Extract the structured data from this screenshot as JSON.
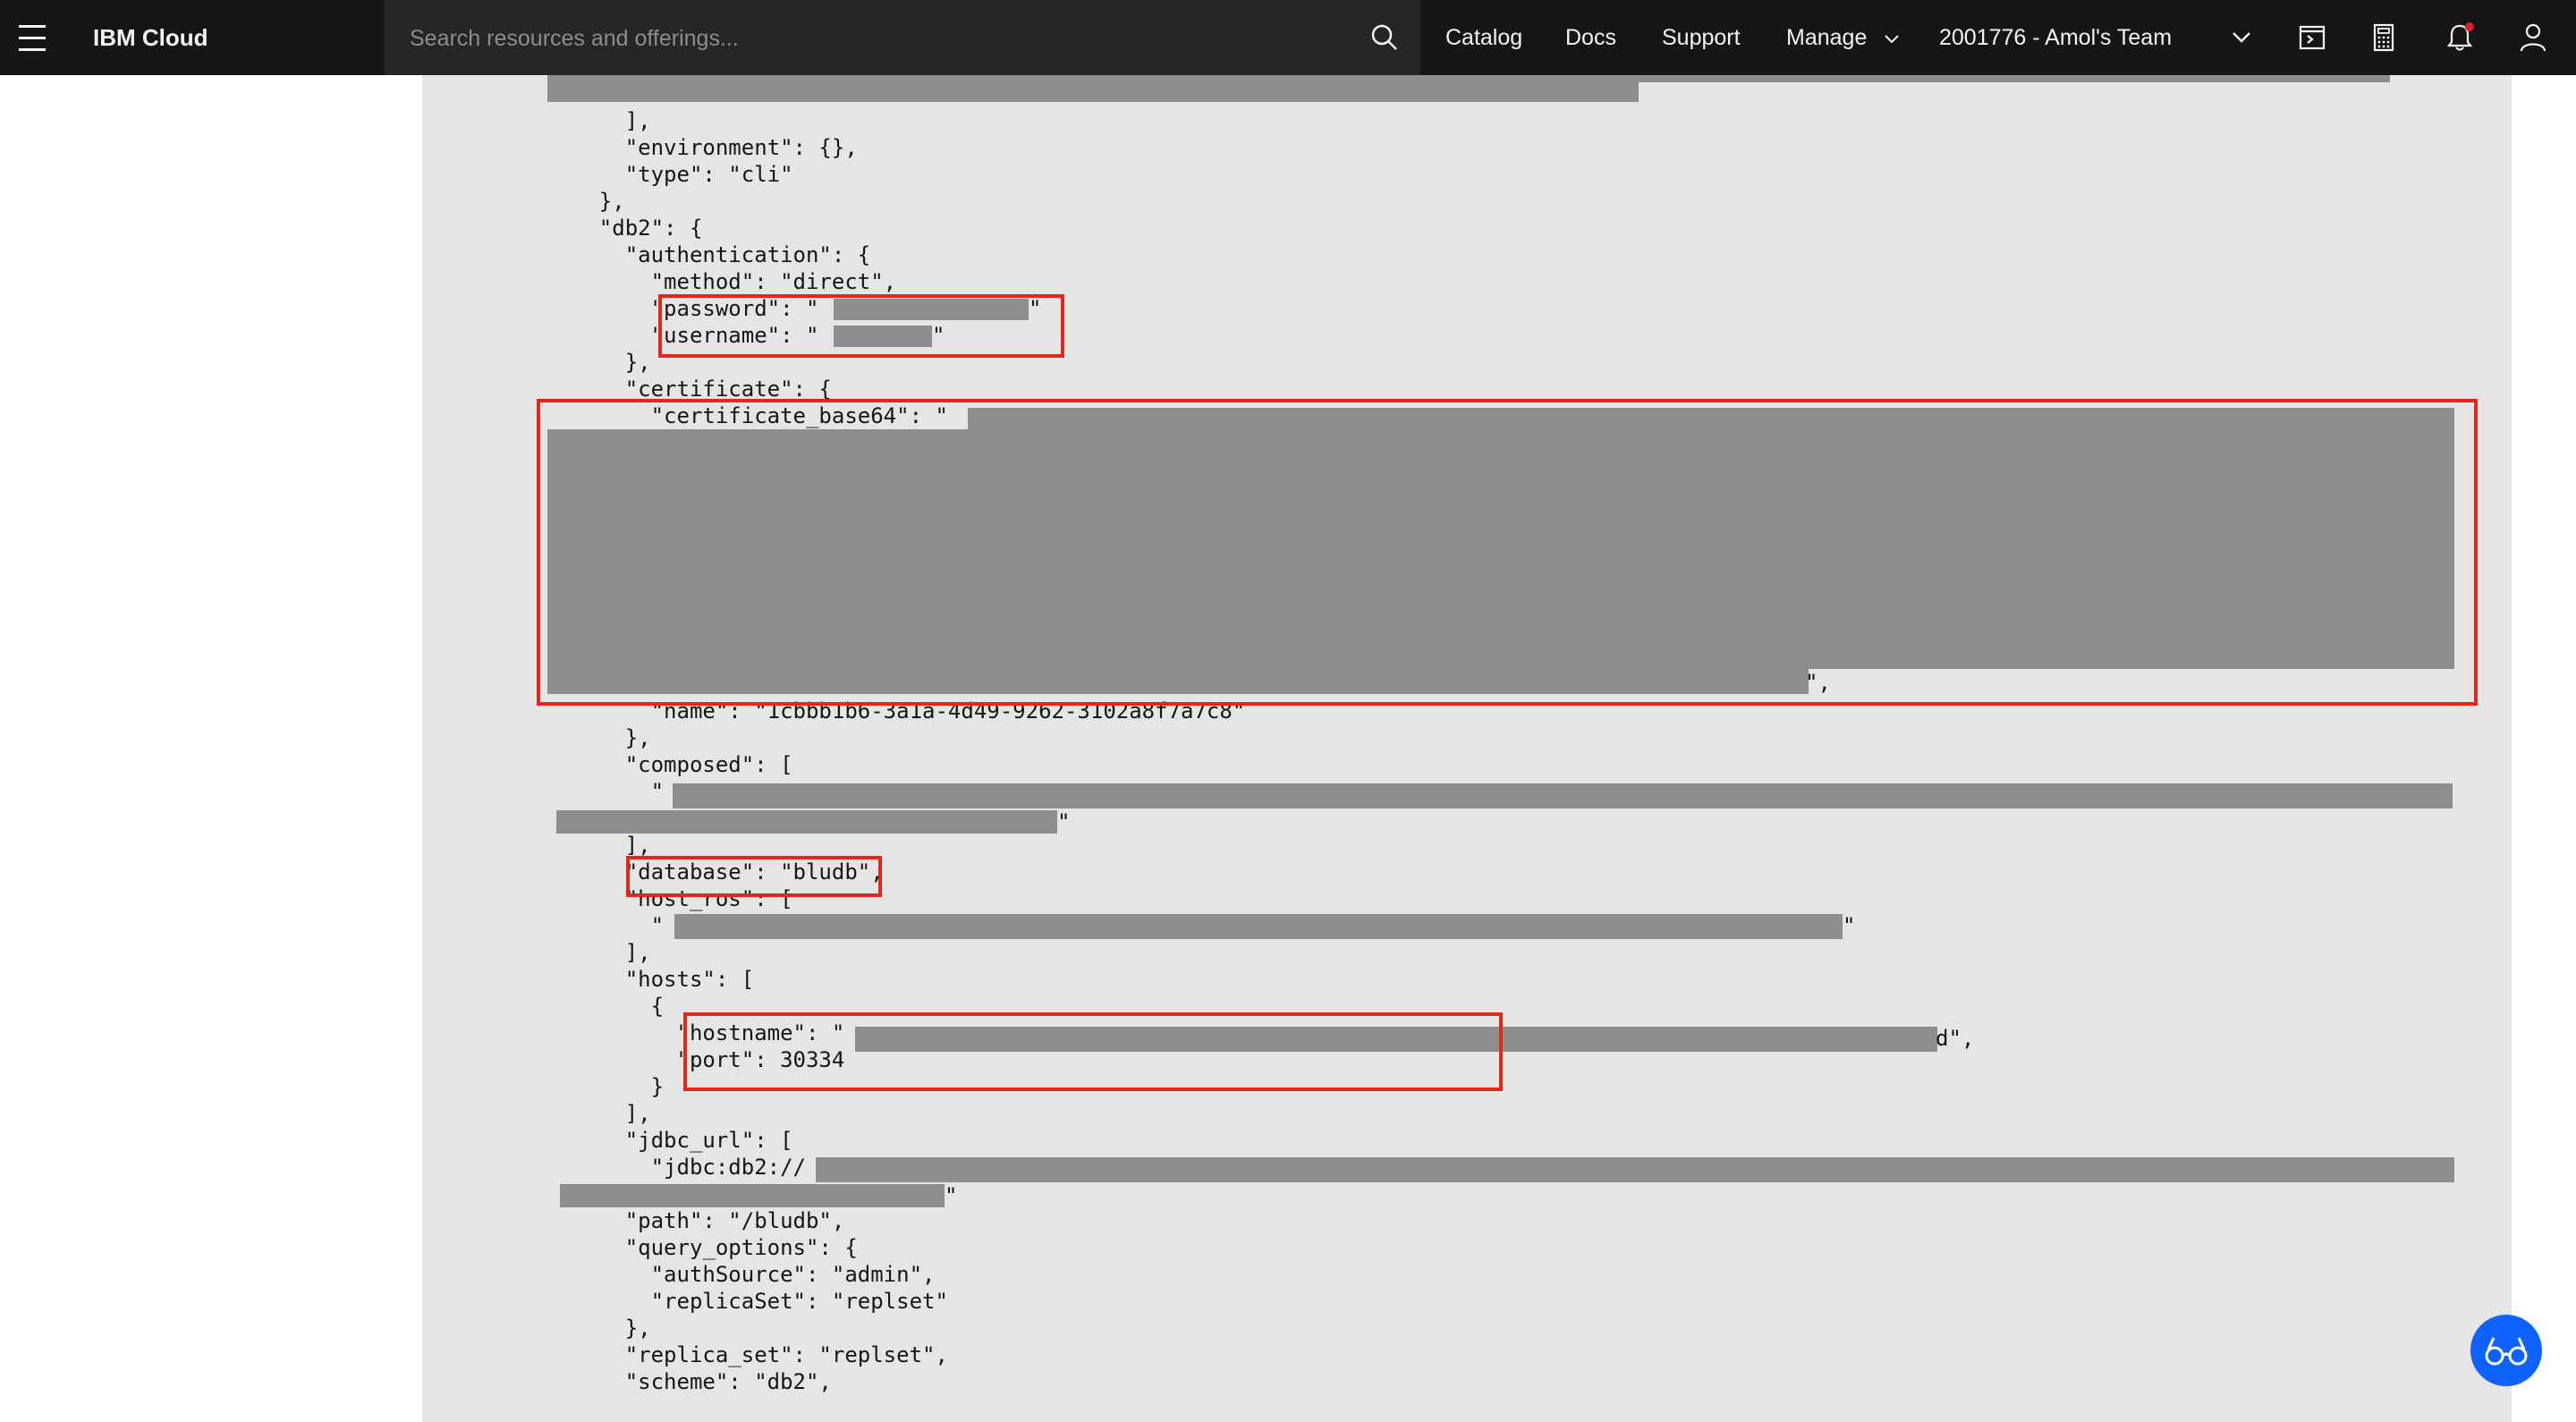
{
  "header": {
    "brand": "IBM Cloud",
    "search_placeholder": "Search resources and offerings...",
    "nav": [
      "Catalog",
      "Docs",
      "Support",
      "Manage"
    ],
    "account": "2001776 - Amol's Team",
    "icons": [
      "menu-icon",
      "search-icon",
      "chevron-down-icon",
      "terminal-icon",
      "calculator-icon",
      "notification-icon",
      "user-icon"
    ]
  },
  "json_view": {
    "lines": [
      "      ],",
      "      \"environment\": {},",
      "      \"type\": \"cli\"",
      "    },",
      "    \"db2\": {",
      "      \"authentication\": {",
      "        \"method\": \"direct\",",
      "        \"password\": \"",
      "        \"username\": \"",
      "      },",
      "      \"certificate\": {",
      "        \"certificate_base64\": \"",
      "        \"name\": \"1cbbb1b6-3a1a-4d49-9262-3102a8f7a7c8\"",
      "      },",
      "      \"composed\": [",
      "        \"",
      "      ],",
      "      \"database\": \"bludb\",",
      "      \"host_ros\": [",
      "        \"",
      "      ],",
      "      \"hosts\": [",
      "        {",
      "          \"hostname\": \"",
      "          \"port\": 30334",
      "        }",
      "      ],",
      "      \"jdbc_url\": [",
      "        \"jdbc:db2://",
      "      ],",
      "      \"path\": \"/bludb\",",
      "      \"query_options\": {",
      "        \"authSource\": \"admin\",",
      "        \"replicaSet\": \"replset\"",
      "      },",
      "      \"replica_set\": \"replset\",",
      "      \"scheme\": \"db2\","
    ]
  },
  "colors": {
    "header_bg": "#161616",
    "search_bg": "#262626",
    "panel_bg": "#e5e5e5",
    "redaction": "#8e8e8e",
    "highlight": "#e0291c",
    "notification_dot": "#da1e28",
    "assist_button": "#0f62fe"
  }
}
